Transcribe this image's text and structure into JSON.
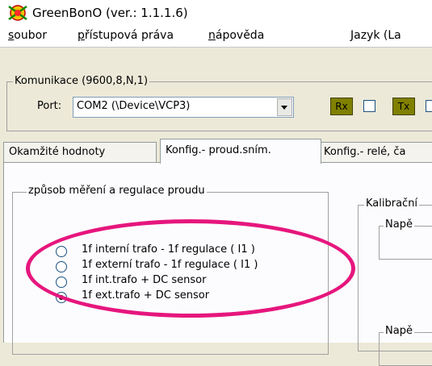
{
  "window": {
    "title": "GreenBonO (ver.: 1.1.1.6)"
  },
  "menu": {
    "items": [
      {
        "first": "s",
        "rest": "oubor"
      },
      {
        "first": "p",
        "rest": "řístupová práva"
      },
      {
        "first": "n",
        "rest": "ápověda"
      },
      {
        "first": "J",
        "rest": "azyk (La"
      }
    ]
  },
  "communication": {
    "legend": "Komunikace (9600,8,N,1)",
    "port_label": "Port:",
    "port_value": "COM2 (\\Device\\VCP3)",
    "rx_label": "Rx",
    "tx_label": "Tx"
  },
  "tabs": [
    {
      "label": "Okamžité hodnoty",
      "active": false
    },
    {
      "label": "Konfig.- proud.sním.",
      "active": true
    },
    {
      "label": "Konfig.- relé, ča",
      "active": false
    }
  ],
  "measurement": {
    "legend": "způsob měření a regulace proudu",
    "options": [
      {
        "label": "1f interní trafo - 1f regulace ( I1 )",
        "selected": false
      },
      {
        "label": "1f externí trafo - 1f regulace ( I1 )",
        "selected": false
      },
      {
        "label": "1f int.trafo + DC sensor",
        "selected": false
      },
      {
        "label": "1f ext.trafo + DC sensor",
        "selected": true
      }
    ]
  },
  "calibration": {
    "legend": "Kalibrační",
    "sub1": "Napě",
    "sub2": "Napě"
  },
  "colors": {
    "highlight": "#e6167d",
    "led": "#808000"
  }
}
